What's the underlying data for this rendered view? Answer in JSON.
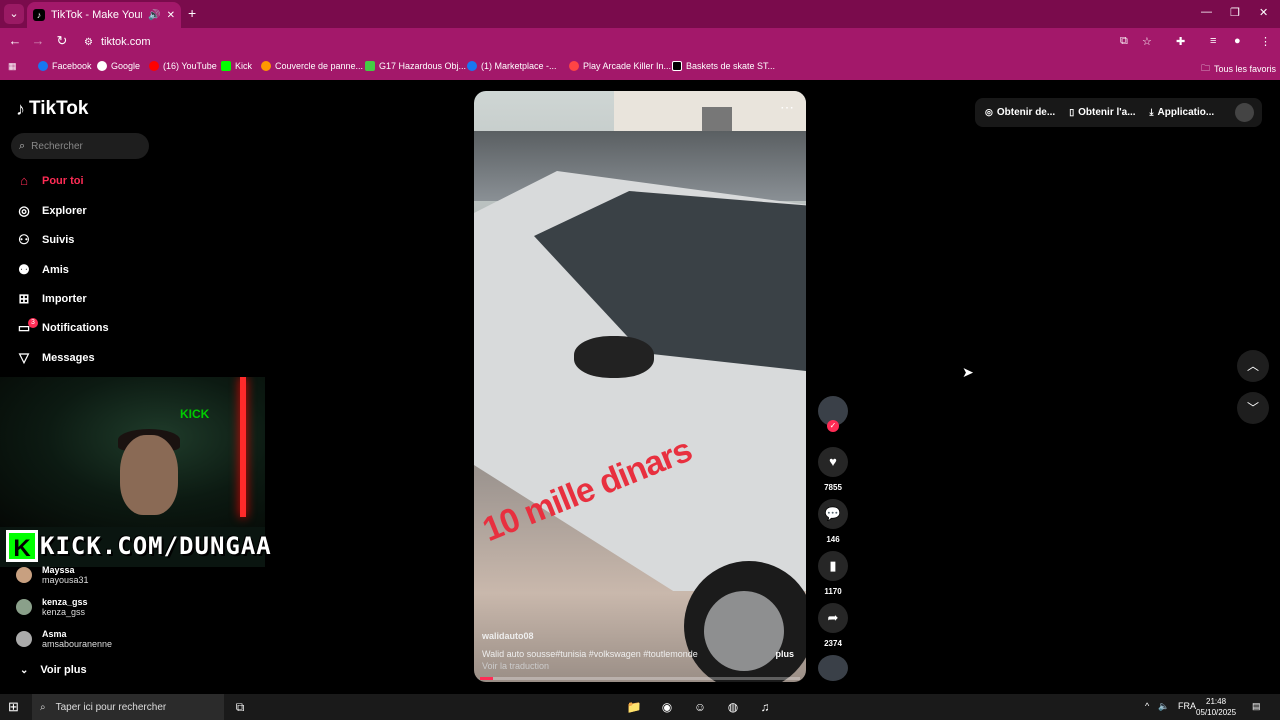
{
  "browser": {
    "tab_title": "TikTok - Make Your Day",
    "url": "tiktok.com",
    "bookmarks": [
      "Facebook",
      "Google",
      "(16) YouTube",
      "Kick",
      "Couvercle de panne...",
      "G17 Hazardous Obj...",
      "(1) Marketplace -...",
      "Play Arcade Killer In...",
      "Baskets de skate ST..."
    ],
    "all_bookmarks": "Tous les favoris"
  },
  "sidebar": {
    "logo": "TikTok",
    "search_placeholder": "Rechercher",
    "items": [
      {
        "label": "Pour toi",
        "icon": "home-icon"
      },
      {
        "label": "Explorer",
        "icon": "compass-icon"
      },
      {
        "label": "Suivis",
        "icon": "following-icon"
      },
      {
        "label": "Amis",
        "icon": "friends-icon"
      },
      {
        "label": "Importer",
        "icon": "upload-icon"
      },
      {
        "label": "Notifications",
        "icon": "inbox-icon",
        "badge": "3"
      },
      {
        "label": "Messages",
        "icon": "send-icon"
      }
    ],
    "following": [
      {
        "name": "Mayssa",
        "username": "mayousa31"
      },
      {
        "name": "kenza_gss",
        "username": "kenza_gss"
      },
      {
        "name": "Asma",
        "username": "amsabouranenne"
      }
    ],
    "see_more": "Voir plus"
  },
  "stream_overlay": {
    "kick_letter": "K",
    "kick_text": "KICK.COM/DUNGAA",
    "kick_webcam_tag": "KICK"
  },
  "video": {
    "overlay_text": "10 mille dinars",
    "author": "walidauto08",
    "caption": "Walid auto sousse#tunisia #volkswagen #toutlemonde",
    "more": "plus",
    "translate": "Voir la traduction",
    "progress": 0.04
  },
  "actions": {
    "likes": "7855",
    "comments": "146",
    "saves": "1170",
    "shares": "2374"
  },
  "top_right": {
    "item1": "Obtenir de...",
    "item2": "Obtenir l'a...",
    "item3": "Applicatio..."
  },
  "taskbar": {
    "search": "Taper ici pour rechercher",
    "lang": "FRA",
    "time": "21:48",
    "date": "05/10/2025"
  },
  "colors": {
    "brand": "#fe2c55",
    "chrome": "#a3186a"
  }
}
